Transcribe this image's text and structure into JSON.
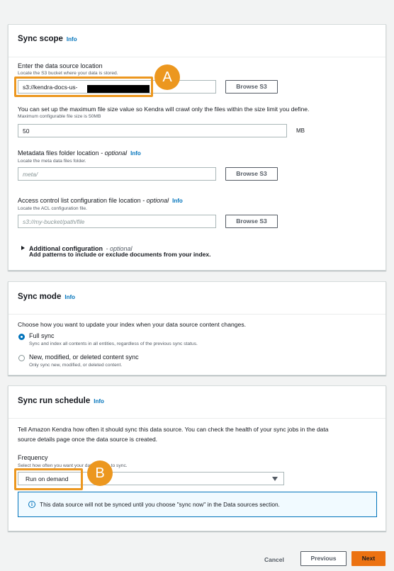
{
  "sync_scope": {
    "title": "Sync scope",
    "info": "Info",
    "location_label": "Enter the data source location",
    "location_desc": "Locate the S3 bucket where your data is stored.",
    "location_value": "s3://kendra-docs-us-",
    "browse_label": "Browse S3",
    "max_size_text": "You can set up the maximum file size value so Kendra will crawl only the files within the size limit you define.",
    "max_size_desc": "Maximum configurable file size is 50MB",
    "max_size_value": "50",
    "max_size_unit": "MB",
    "metadata_label": "Metadata files folder location",
    "optional": "- optional",
    "metadata_desc": "Locate the meta data files folder.",
    "metadata_placeholder": "meta/",
    "acl_label": "Access control list configuration file location",
    "acl_desc": "Locate the ACL configuration file.",
    "acl_placeholder": "s3://my-bucket/path/file",
    "additional_label": "Additional configuration",
    "additional_desc": "Add patterns to include or exclude documents from your index."
  },
  "sync_mode": {
    "title": "Sync mode",
    "info": "Info",
    "question": "Choose how you want to update your index when your data source content changes.",
    "options": [
      {
        "label": "Full sync",
        "desc": "Sync and index all contents in all entities, regardless of the previous sync status.",
        "selected": true
      },
      {
        "label": "New, modified, or deleted content sync",
        "desc": "Only sync new, modified, or deleted content.",
        "selected": false
      }
    ]
  },
  "sync_schedule": {
    "title": "Sync run schedule",
    "info": "Info",
    "text_line1": "Tell Amazon Kendra how often it should sync this data source. You can check the health of your sync jobs in the data",
    "text_line2": "source details page once the data source is created.",
    "frequency_label": "Frequency",
    "frequency_desc": "Select how often you want your data source to sync.",
    "frequency_value": "Run on demand",
    "alert_text": "This data source will not be synced until you choose \"sync now\" in the Data sources section."
  },
  "callouts": {
    "a": "A",
    "b": "B"
  },
  "footer": {
    "cancel": "Cancel",
    "previous": "Previous",
    "next": "Next"
  },
  "colors": {
    "accent": "#ec971f",
    "primary_button": "#ec7211",
    "link": "#0073bb"
  }
}
